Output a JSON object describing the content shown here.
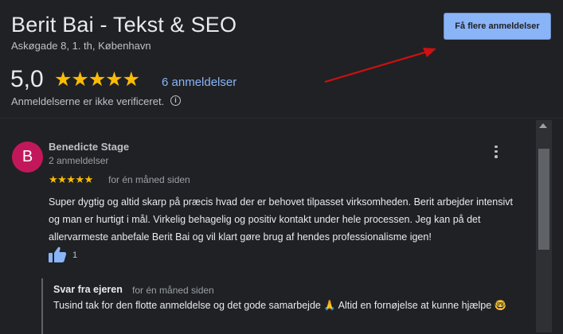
{
  "business": {
    "name": "Berit Bai - Tekst & SEO",
    "address": "Askøgade 8, 1. th, København",
    "rating": "5,0",
    "stars": "★★★★★",
    "review_count": "6 anmeldelser",
    "unverified": "Anmeldelserne er ikke verificeret.",
    "info_icon": "i"
  },
  "actions": {
    "more_reviews_label": "Få flere anmeldelser"
  },
  "review": {
    "avatar_letter": "B",
    "reviewer_name": "Benedicte Stage",
    "reviewer_reviews": "2 anmeldelser",
    "stars": "★★★★★",
    "time": "for én måned siden",
    "text": "Super dygtig og altid skarp på præcis hvad der er behovet tilpasset virksomheden. Berit arbejder intensivt og man er hurtigt i mål. Virkelig behagelig og positiv kontakt under hele processen. Jeg kan på det allervarmeste anbefale Berit Bai og vil klart gøre brug af hendes professionalisme igen!",
    "likes": "1"
  },
  "owner_reply": {
    "title": "Svar fra ejeren",
    "time": "for én måned siden",
    "text": "Tusind tak for den flotte anmeldelse og det gode samarbejde 🙏 Altid en fornøjelse at kunne hjælpe 🤓"
  },
  "colors": {
    "background": "#202124",
    "accent": "#8ab4f8",
    "star": "#fbbc04",
    "avatar": "#c2185b",
    "annotation_arrow": "#d01010"
  },
  "icons": [
    "info-icon",
    "more-vert-icon",
    "thumbs-up-icon",
    "scroll-up-icon"
  ]
}
